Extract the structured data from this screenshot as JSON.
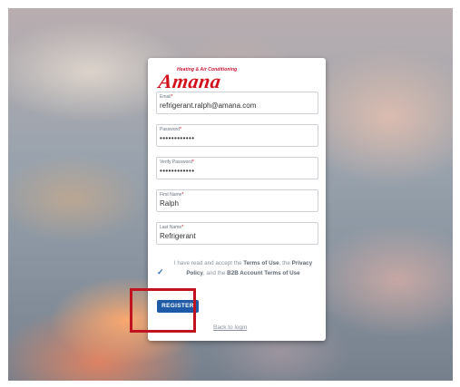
{
  "brand": {
    "tagline": "Heating & Air Conditioning",
    "name": "Amana"
  },
  "form": {
    "email": {
      "label": "Email",
      "required_mark": "*",
      "value": "refrigerant.ralph@amana.com"
    },
    "password": {
      "label": "Password",
      "required_mark": "*",
      "value": "••••••••••••"
    },
    "verify_password": {
      "label": "Verify Password",
      "required_mark": "*",
      "value": "••••••••••••"
    },
    "first_name": {
      "label": "First Name",
      "required_mark": "*",
      "value": "Ralph"
    },
    "last_name": {
      "label": "Last Name",
      "required_mark": "*",
      "value": "Refrigerant"
    }
  },
  "consent": {
    "checked": true,
    "text_1": "I have read and accept the ",
    "terms_link": "Terms of Use",
    "text_2": ", the ",
    "privacy_link": "Privacy Policy",
    "text_3": ", and the ",
    "b2b_link": "B2B Account Terms of Use",
    "check_glyph": "✓"
  },
  "actions": {
    "register_label": "REGISTER",
    "back_to_login": "Back to login"
  },
  "colors": {
    "primary_button": "#1f5aa6",
    "brand_red": "#d1121b",
    "highlight_box": "#c1121f"
  }
}
